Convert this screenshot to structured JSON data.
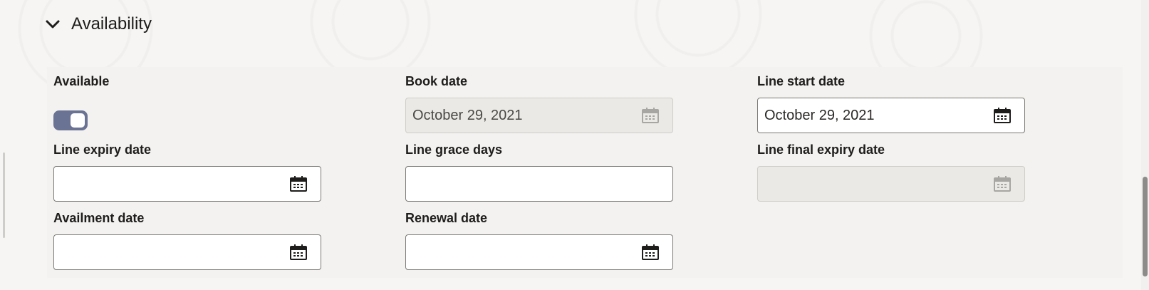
{
  "section": {
    "title": "Availability",
    "expand_icon": "chevron-down-icon"
  },
  "fields": {
    "available": {
      "label": "Available",
      "toggle_on": true,
      "toggle_color": "#6b7395"
    },
    "book_date": {
      "label": "Book date",
      "value": "October 29, 2021",
      "disabled": true,
      "icon": "calendar-icon"
    },
    "line_start_date": {
      "label": "Line start date",
      "value": "October 29, 2021",
      "icon": "calendar-icon"
    },
    "line_expiry_date": {
      "label": "Line expiry date",
      "value": "",
      "icon": "calendar-icon"
    },
    "line_grace_days": {
      "label": "Line grace days",
      "value": ""
    },
    "line_final_expiry_date": {
      "label": "Line final expiry date",
      "value": "",
      "disabled": true,
      "icon": "calendar-icon"
    },
    "availment_date": {
      "label": "Availment date",
      "value": "",
      "icon": "calendar-icon"
    },
    "renewal_date": {
      "label": "Renewal date",
      "value": "",
      "icon": "calendar-icon"
    }
  },
  "colors": {
    "panel_bg": "#f3f2f0",
    "page_bg": "#f6f5f3",
    "text": "#1e1d1b"
  }
}
